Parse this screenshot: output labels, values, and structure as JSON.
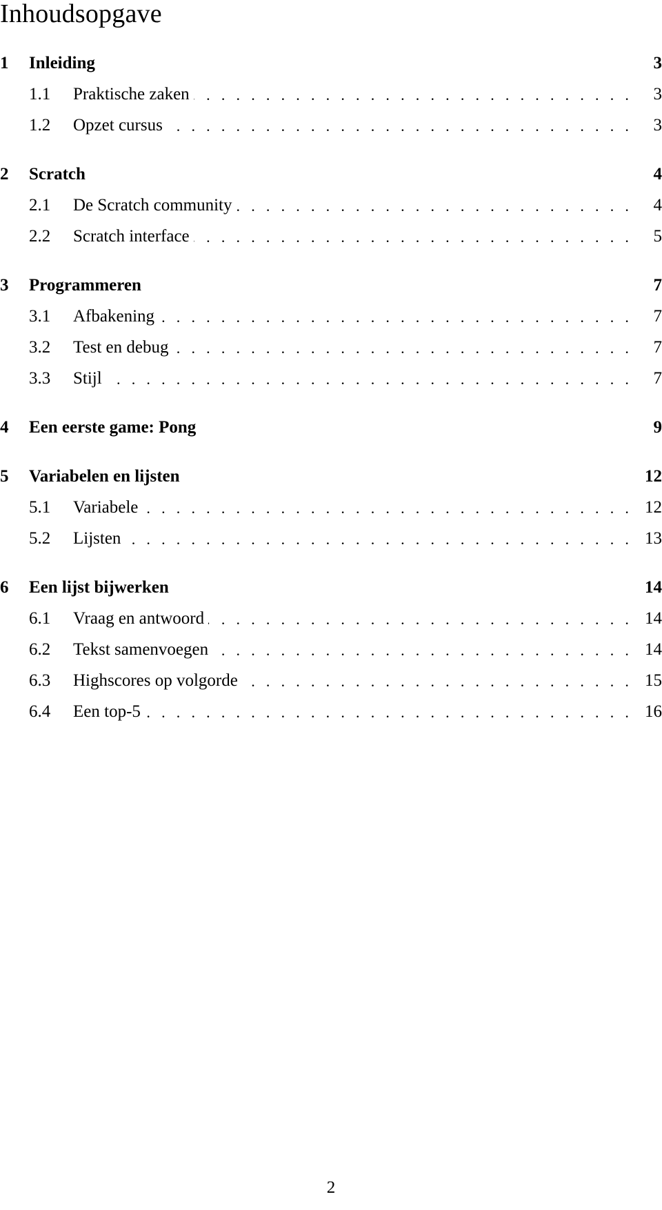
{
  "page": {
    "title": "Inhoudsopgave",
    "page_number": "2"
  },
  "toc": [
    {
      "number": "1",
      "title": "Inleiding",
      "page": "3",
      "sections": [
        {
          "number": "1.1",
          "title": "Praktische zaken",
          "page": "3"
        },
        {
          "number": "1.2",
          "title": "Opzet cursus",
          "page": "3"
        }
      ]
    },
    {
      "number": "2",
      "title": "Scratch",
      "page": "4",
      "sections": [
        {
          "number": "2.1",
          "title": "De Scratch community",
          "page": "4"
        },
        {
          "number": "2.2",
          "title": "Scratch interface",
          "page": "5"
        }
      ]
    },
    {
      "number": "3",
      "title": "Programmeren",
      "page": "7",
      "sections": [
        {
          "number": "3.1",
          "title": "Afbakening",
          "page": "7"
        },
        {
          "number": "3.2",
          "title": "Test en debug",
          "page": "7"
        },
        {
          "number": "3.3",
          "title": "Stijl",
          "page": "7"
        }
      ]
    },
    {
      "number": "4",
      "title": "Een eerste game: Pong",
      "page": "9",
      "sections": []
    },
    {
      "number": "5",
      "title": "Variabelen en lijsten",
      "page": "12",
      "sections": [
        {
          "number": "5.1",
          "title": "Variabele",
          "page": "12"
        },
        {
          "number": "5.2",
          "title": "Lijsten",
          "page": "13"
        }
      ]
    },
    {
      "number": "6",
      "title": "Een lijst bijwerken",
      "page": "14",
      "sections": [
        {
          "number": "6.1",
          "title": "Vraag en antwoord",
          "page": "14"
        },
        {
          "number": "6.2",
          "title": "Tekst samenvoegen",
          "page": "14"
        },
        {
          "number": "6.3",
          "title": "Highscores op volgorde",
          "page": "15"
        },
        {
          "number": "6.4",
          "title": "Een top-5",
          "page": "16"
        }
      ]
    }
  ]
}
